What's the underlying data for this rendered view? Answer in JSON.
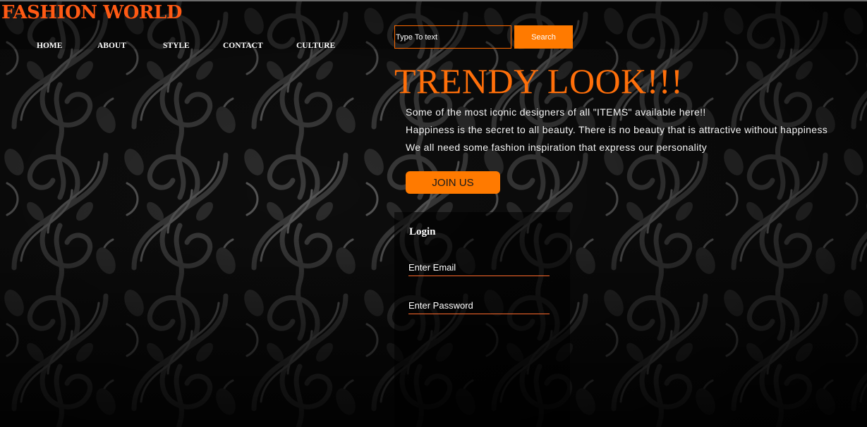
{
  "brand": {
    "logo": "FASHION WORLD",
    "accent_color": "#ff6a00"
  },
  "nav": {
    "items": [
      {
        "label": "HOME"
      },
      {
        "label": "ABOUT"
      },
      {
        "label": "STYLE"
      },
      {
        "label": "CONTACT"
      },
      {
        "label": "CULTURE"
      }
    ]
  },
  "search": {
    "placeholder": "Type To text",
    "button_label": "Search"
  },
  "hero": {
    "title": "TRENDY LOOK!!!",
    "lines": [
      "Some of the most iconic designers of all \"ITEMS\" available here!!",
      "Happiness is the secret to all beauty. There is no beauty that is attractive without happiness",
      "We all need some fashion inspiration that express our personality"
    ],
    "cta_label": "JOIN US"
  },
  "login": {
    "title": "Login",
    "email_placeholder": "Enter Email",
    "password_placeholder": "Enter Password"
  }
}
